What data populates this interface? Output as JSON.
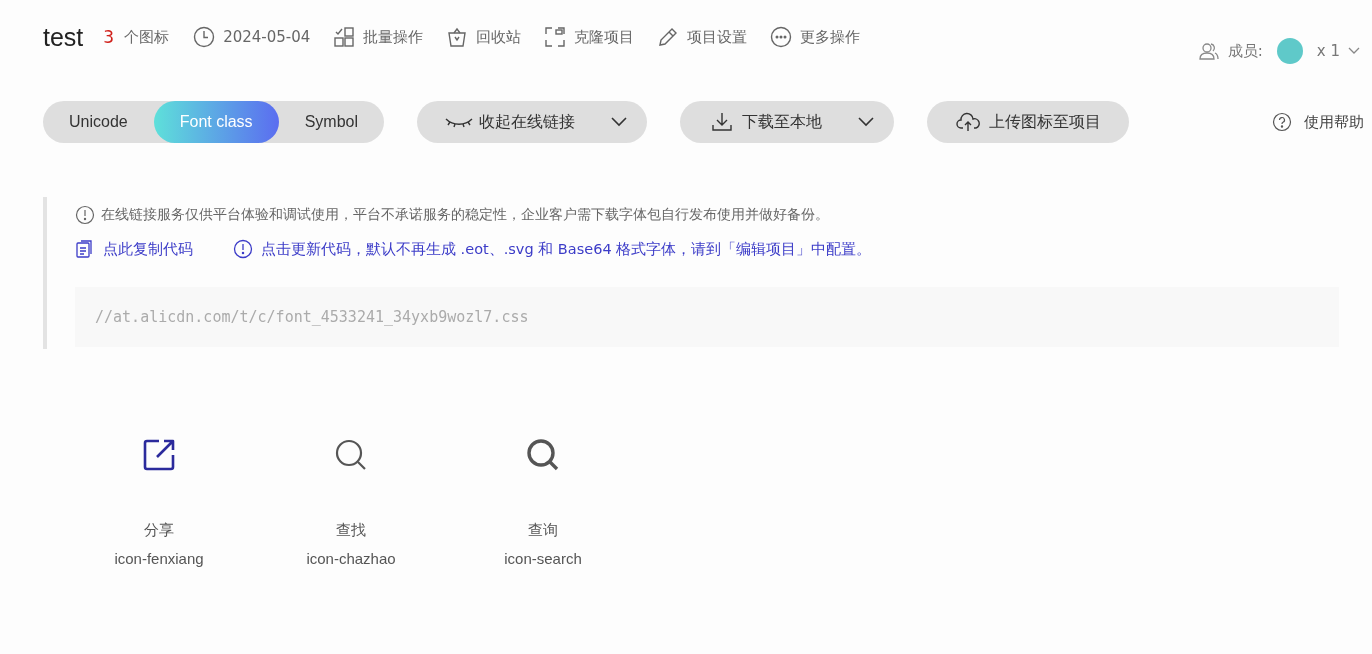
{
  "project": {
    "name": "test",
    "icon_count": "3",
    "icon_count_label": "个图标"
  },
  "toolbar": [
    {
      "kind": "clock",
      "label": "2024-05-04"
    },
    {
      "kind": "batch",
      "label": "批量操作"
    },
    {
      "kind": "trash",
      "label": "回收站"
    },
    {
      "kind": "clone",
      "label": "克隆项目"
    },
    {
      "kind": "pencil",
      "label": "项目设置"
    },
    {
      "kind": "more",
      "label": "更多操作"
    }
  ],
  "members": {
    "label": "成员:",
    "count": "x 1"
  },
  "format_tabs": [
    {
      "label": "Unicode",
      "selected": false
    },
    {
      "label": "Font class",
      "selected": true
    },
    {
      "label": "Symbol",
      "selected": false
    }
  ],
  "actions": [
    {
      "kind": "eye",
      "label": "收起在线链接",
      "dropdown": true
    },
    {
      "kind": "download",
      "label": "下载至本地",
      "dropdown": true
    },
    {
      "kind": "upload",
      "label": "上传图标至项目",
      "dropdown": false
    }
  ],
  "help": "使用帮助",
  "notice": "在线链接服务仅供平台体验和调试使用，平台不承诺服务的稳定性，企业客户需下载字体包自行发布使用并做好备份。",
  "copy_link": "点此复制代码",
  "update_link": "点击更新代码，默认不再生成 .eot、.svg 和 Base64 格式字体，请到「编辑项目」中配置。",
  "code": "//at.alicdn.com/t/c/font_4533241_34yxb9wozl7.css",
  "icons": [
    {
      "kind": "share",
      "name": "分享",
      "class": "icon-fenxiang",
      "color": "#2b2a9c"
    },
    {
      "kind": "search",
      "name": "查找",
      "class": "icon-chazhao",
      "color": "#555555"
    },
    {
      "kind": "search-bold",
      "name": "查询",
      "class": "icon-search",
      "color": "#555555"
    }
  ]
}
